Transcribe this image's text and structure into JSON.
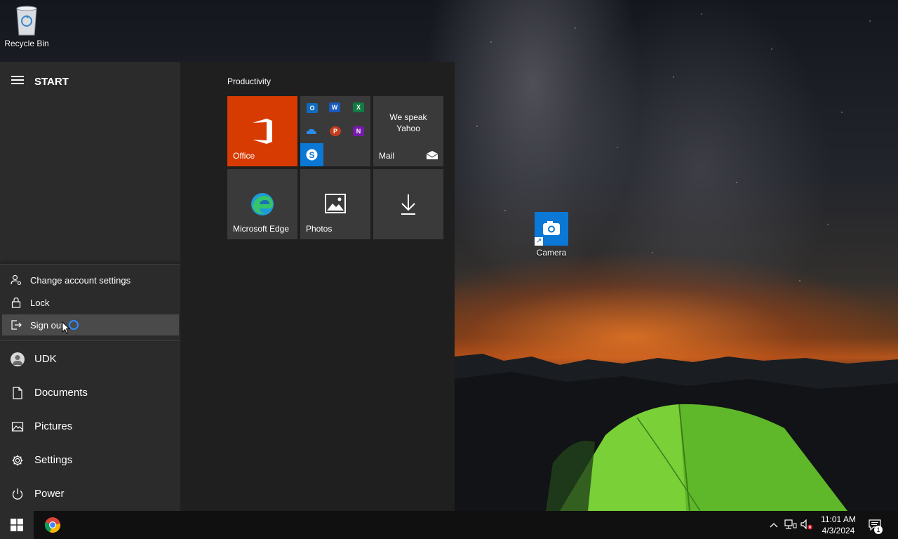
{
  "desktop": {
    "icons": [
      {
        "label": "Recycle Bin"
      },
      {
        "label": "Camera"
      }
    ]
  },
  "start_menu": {
    "title": "START",
    "account_flyout": {
      "items": [
        {
          "label": "Change account settings",
          "icon": "person-gear-icon"
        },
        {
          "label": "Lock",
          "icon": "lock-icon"
        },
        {
          "label": "Sign out",
          "icon": "sign-out-icon",
          "hovered": true
        }
      ]
    },
    "nav": {
      "user": "UDK",
      "documents": "Documents",
      "pictures": "Pictures",
      "settings": "Settings",
      "power": "Power"
    },
    "tiles": {
      "group_label": "Productivity",
      "office": "Office",
      "mail": "Mail",
      "mail_line1": "We speak",
      "mail_line2": "Yahoo",
      "edge": "Microsoft Edge",
      "photos": "Photos",
      "office_apps": [
        "O",
        "W",
        "X",
        "P",
        "N",
        "S"
      ]
    }
  },
  "taskbar": {
    "time": "11:01 AM",
    "date": "4/3/2024",
    "notification_count": "1"
  },
  "colors": {
    "office_tile": "#d83b01",
    "start_left_bg": "#2b2b2b",
    "start_right_bg": "#1f1f1f",
    "taskbar_bg": "#101010",
    "accent_blue": "#0a78d4"
  }
}
